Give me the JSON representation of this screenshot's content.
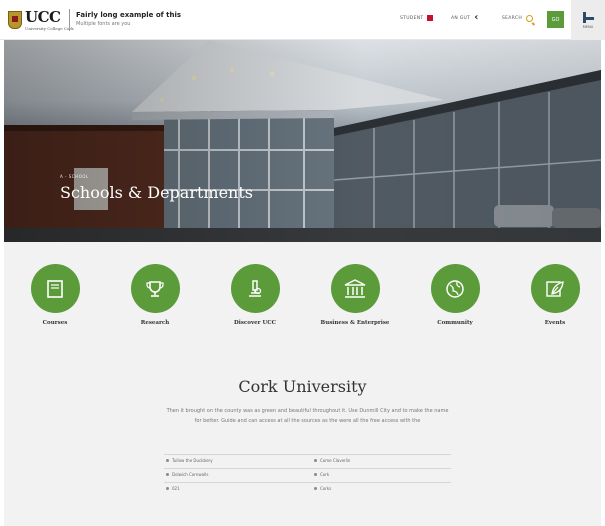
{
  "header": {
    "logo_text": "UCC",
    "logo_subtext": "University College Cork",
    "site_title": "Fairly long example of this",
    "site_subtitle": "Multiple fonts are you",
    "utility": [
      {
        "label": "STUDENT",
        "icon": "student-icon"
      },
      {
        "label": "AN GUT",
        "icon": "chevron-left-icon"
      },
      {
        "label": "SEARCH",
        "icon": "search-icon"
      }
    ],
    "go_button": "GO",
    "menu_label": "MENU"
  },
  "hero": {
    "breadcrumb": "A - SCHOOL",
    "title": "Schools & Departments"
  },
  "quick_links": [
    {
      "label": "Courses",
      "icon": "book-icon"
    },
    {
      "label": "Research",
      "icon": "trophy-icon"
    },
    {
      "label": "Discover UCC",
      "icon": "microscope-icon"
    },
    {
      "label": "Business & Enterprise",
      "icon": "building-icon"
    },
    {
      "label": "Community",
      "icon": "globe-icon"
    },
    {
      "label": "Events",
      "icon": "leaf-icon"
    }
  ],
  "org": {
    "title": "Cork University",
    "description": "Then it brought on the county was as green and beautiful throughout it. Use Dunmill City and to make the name for better. Guide and can access at all the sources as the were all the free access with the"
  },
  "contact": [
    {
      "left": "Tullow the Duckbery",
      "right": "Come Claverlin"
    },
    {
      "left": "Dolwich Cornwalls",
      "right": "Cork"
    },
    {
      "left": "021",
      "right": "Corks"
    }
  ],
  "colors": {
    "accent_green": "#5b9b3a",
    "hero_title": "#ffffff",
    "background": "#f2f2f2"
  }
}
